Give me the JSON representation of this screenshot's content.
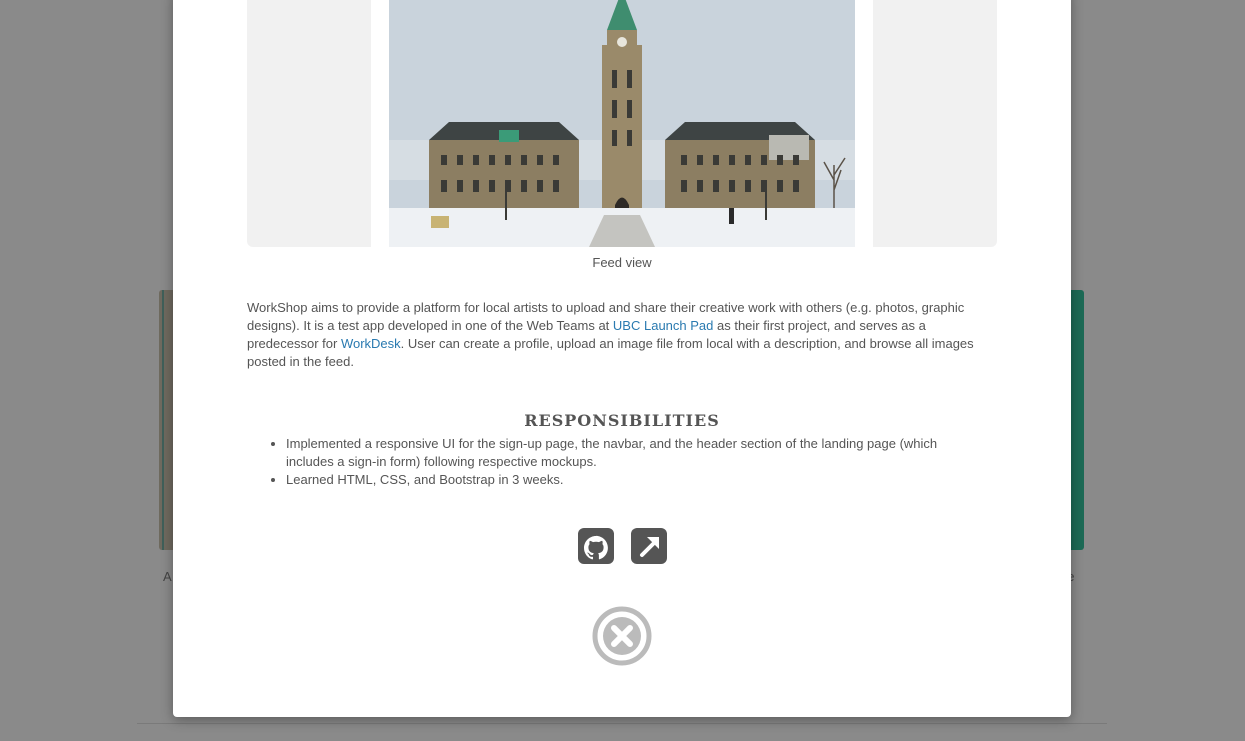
{
  "background": {
    "left_caption": "A",
    "right_caption": "ee"
  },
  "modal": {
    "carousel": {
      "caption": "Feed view"
    },
    "description": {
      "part1": "WorkShop aims to provide a platform for local artists to upload and share their creative work with others (e.g. photos, graphic designs). It is a test app developed in one of the Web Teams at ",
      "link1": "UBC Launch Pad",
      "part2": " as their first project, and serves as a predecessor for ",
      "link2": "WorkDesk",
      "part3": ". User can create a profile, upload an image file from local with a description, and browse all images posted in the feed."
    },
    "responsibilities": {
      "title": "RESPONSIBILITIES",
      "items": [
        "Implemented a responsive UI for the sign-up page, the navbar, and the header section of the landing page (which includes a sign-in form) following respective mockups.",
        "Learned HTML, CSS, and Bootstrap in 3 weeks."
      ]
    },
    "icons": {
      "github": "github-icon",
      "external": "external-link-icon",
      "close": "close-icon"
    }
  },
  "colors": {
    "overlay": "#8a8a8a",
    "link": "#2a7ab0",
    "icon": "#555555",
    "close_icon": "#bbbbbb"
  }
}
